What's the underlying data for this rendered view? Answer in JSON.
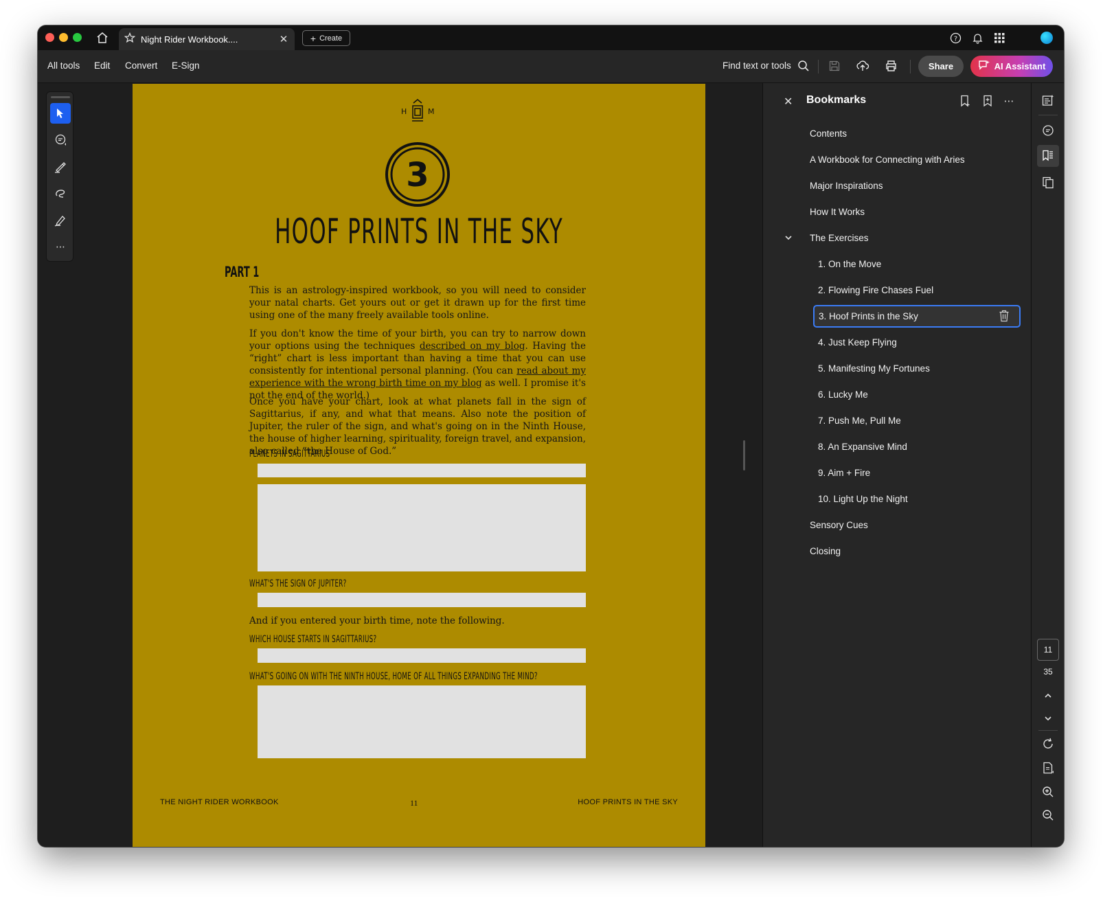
{
  "window": {
    "tab_title": "Night Rider Workbook....",
    "create_label": "Create"
  },
  "toolbar": {
    "menu": [
      "All tools",
      "Edit",
      "Convert",
      "E-Sign"
    ],
    "find_label": "Find text or tools",
    "share_label": "Share",
    "ai_label": "AI Assistant"
  },
  "document": {
    "logo_left": "H",
    "logo_right": "M",
    "chapter_number": "3",
    "chapter_title": "HOOF PRINTS IN THE SKY",
    "part_heading": "PART 1",
    "para1": "This is an astrology-inspired workbook, so you will need to consider your natal charts. Get yours out or get it drawn up for the first time using one of the many freely available tools online.",
    "para2_a": "If you don't know the time of your birth, you can try to narrow down your options using the techniques ",
    "para2_link1": "described on my blog",
    "para2_b": ". Having the “right” chart is less important than having a time that you can use consistently for intentional personal planning. (You can ",
    "para2_link2": "read about my experience with the wrong birth time on my blog",
    "para2_c": " as well. I promise it's not the end of the world.)",
    "para3": "Once you have your chart, look at what planets fall in the sign of Sagittarius, if any, and what that means. Also note the position of Jupiter, the ruler of the sign, and what's going on in the Ninth House, the house of higher learning, spirituality, foreign travel, and expansion, also called “the House of God.”",
    "label_planets": "PLANETS IN SAGITTARIUS",
    "label_jupiter": "WHAT'S THE SIGN OF JUPITER?",
    "note_birth_time": "And if you entered your birth time, note the following.",
    "label_house": "WHICH HOUSE STARTS IN SAGITTARIUS?",
    "label_ninth": "WHAT'S GOING ON WITH THE NINTH HOUSE, HOME OF ALL THINGS EXPANDING THE MIND?",
    "footer_left": "THE NIGHT RIDER WORKBOOK",
    "footer_page": "11",
    "footer_right": "HOOF PRINTS IN THE SKY"
  },
  "bookmarks": {
    "title": "Bookmarks",
    "items": [
      {
        "label": "Contents"
      },
      {
        "label": "A Workbook for Connecting with Aries"
      },
      {
        "label": "Major Inspirations"
      },
      {
        "label": "How It Works"
      },
      {
        "label": "The Exercises"
      },
      {
        "label": "1. On the Move"
      },
      {
        "label": "2. Flowing Fire Chases Fuel"
      },
      {
        "label": "3. Hoof Prints in the Sky"
      },
      {
        "label": "4. Just Keep Flying"
      },
      {
        "label": "5. Manifesting My Fortunes"
      },
      {
        "label": "6. Lucky Me"
      },
      {
        "label": "7. Push Me, Pull Me"
      },
      {
        "label": "8. An Expansive Mind"
      },
      {
        "label": "9. Aim + Fire"
      },
      {
        "label": "10. Light Up the Night"
      },
      {
        "label": "Sensory Cues"
      },
      {
        "label": "Closing"
      }
    ],
    "selected_index": 7
  },
  "page_nav": {
    "current": "11",
    "total": "35"
  },
  "colors": {
    "page_bg": "#ad8b00",
    "accent": "#1d5ff0",
    "selection_border": "#3b7cf6"
  }
}
